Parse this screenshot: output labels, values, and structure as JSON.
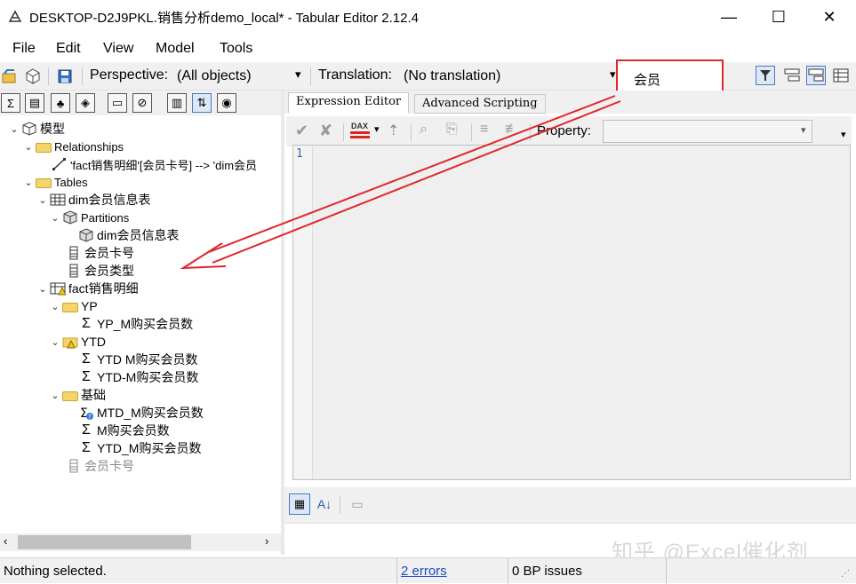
{
  "window": {
    "title": "DESKTOP-D2J9PKL.销售分析demo_local* - Tabular Editor 2.12.4",
    "minimize": "—",
    "maximize": "☐",
    "close": "✕"
  },
  "menu": [
    "File",
    "Edit",
    "View",
    "Model",
    "Tools"
  ],
  "toolbar": {
    "perspective_label": "Perspective:",
    "perspective_value": "(All objects)",
    "translation_label": "Translation:",
    "translation_value": "(No translation)",
    "search_value": "会员",
    "dropdown_arrow": "▾"
  },
  "tree": {
    "root": "模型",
    "relationships": "Relationships",
    "relationship_item": "'fact销售明细'[会员卡号] --> 'dim会员",
    "tables": "Tables",
    "dim_table": "dim会员信息表",
    "partitions": "Partitions",
    "partition_item": "dim会员信息表",
    "col_card": "会员卡号",
    "col_type": "会员类型",
    "fact_table": "fact销售明细",
    "folder_yp": "YP",
    "m_yp": "YP_M购买会员数",
    "folder_ytd": "YTD",
    "m_ytd1": "YTD M购买会员数",
    "m_ytd2": "YTD-M购买会员数",
    "folder_base": "基础",
    "m_mtd": "MTD_M购买会员数",
    "m_m": "M购买会员数",
    "m_ytd3": "YTD_M购买会员数",
    "col_card_hidden": "会员卡号"
  },
  "editor": {
    "tab_expression": "Expression Editor",
    "tab_advanced": "Advanced Scripting",
    "property_label": "Property:",
    "line_number": "1",
    "dax_label": "DAX"
  },
  "status": {
    "selection": "Nothing selected.",
    "errors": "2 errors",
    "bp_issues": "0 BP issues"
  },
  "watermark": "知乎 @Excel催化剂",
  "colors": {
    "annotation_red": "#e0262c",
    "folder_yellow": "#f5d46a",
    "link_blue": "#1a4ec2"
  }
}
